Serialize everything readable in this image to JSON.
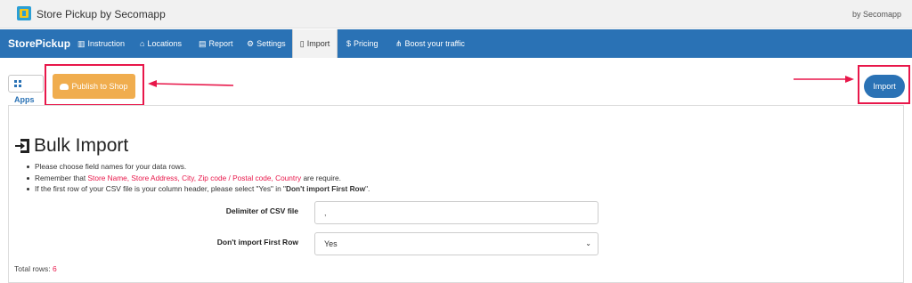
{
  "window": {
    "app_title": "Store Pickup by Secomapp",
    "by_label": "by Secomapp"
  },
  "nav": {
    "brand": "StorePickup",
    "items": [
      {
        "label": "Instruction",
        "icon": "book-icon"
      },
      {
        "label": "Locations",
        "icon": "buildings-icon"
      },
      {
        "label": "Report",
        "icon": "document-icon"
      },
      {
        "label": "Settings",
        "icon": "gear-icon"
      },
      {
        "label": "Import",
        "icon": "file-icon",
        "active": true
      },
      {
        "label": "Pricing",
        "icon": "dollar-icon"
      },
      {
        "label": "Boost your traffic",
        "icon": "share-icon"
      }
    ]
  },
  "toolbar": {
    "apps_label": "Apps",
    "publish_label": "Publish to Shop",
    "import_label": "Import"
  },
  "bulk": {
    "title": "Bulk Import",
    "note1": "Please choose field names for your data rows.",
    "note2_prefix": "Remember that ",
    "note2_required": "Store Name, Store Address, City, Zip code / Postal code, Country",
    "note2_suffix": " are require.",
    "note3_prefix": "If the first row of your CSV file is your column header, please select \"Yes\" in \"",
    "note3_bold": "Don't import First Row",
    "note3_suffix": "\".",
    "delimiter_label": "Delimiter of CSV file",
    "delimiter_value": ",",
    "skip_label": "Don't import First Row",
    "skip_value": "Yes",
    "total_label": "Total rows:",
    "total_value": "6"
  },
  "colors": {
    "nav_blue": "#2a72b5",
    "publish_orange": "#f0ad4e",
    "highlight_red": "#e8174a"
  }
}
